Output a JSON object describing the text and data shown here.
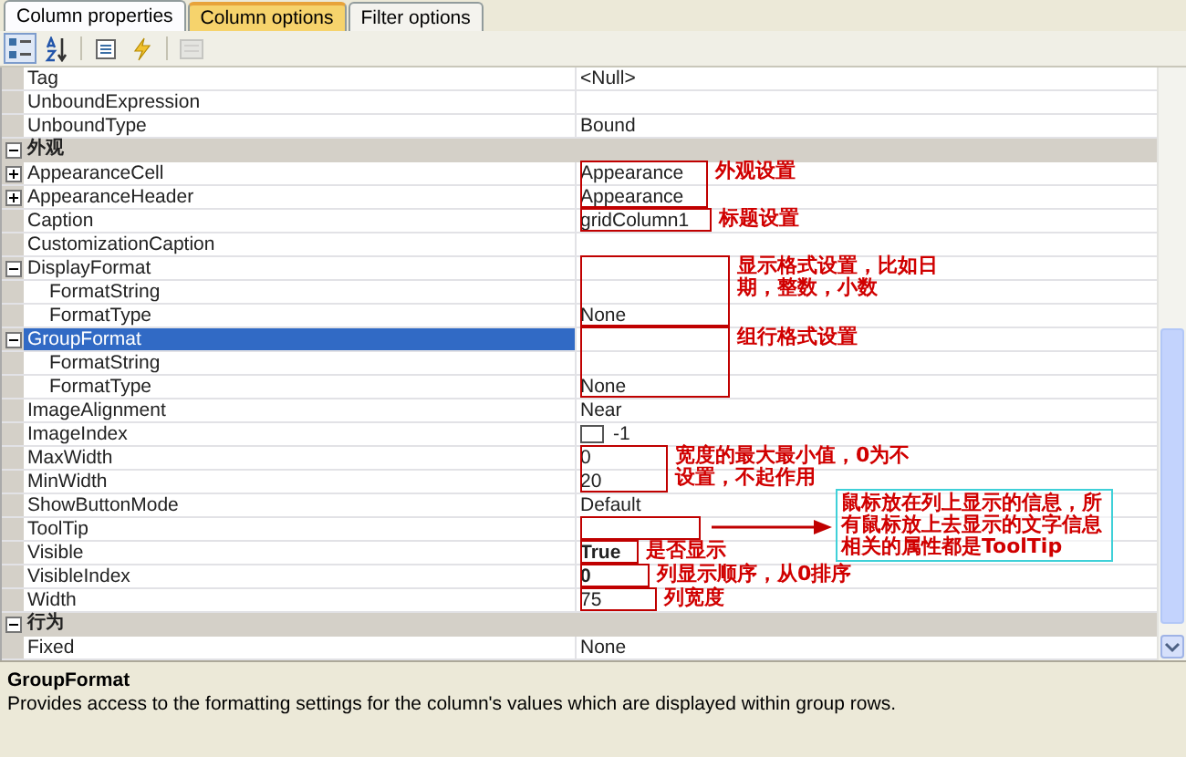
{
  "tabs": [
    {
      "label": "Column properties",
      "selected": true,
      "hovered": false
    },
    {
      "label": "Column options",
      "selected": false,
      "hovered": true
    },
    {
      "label": "Filter options",
      "selected": false,
      "hovered": false
    }
  ],
  "toolbar": [
    {
      "kind": "categorized",
      "selected": true,
      "disabled": false
    },
    {
      "kind": "alphabetical",
      "selected": false,
      "disabled": false
    },
    {
      "kind": "properties",
      "selected": false,
      "disabled": false
    },
    {
      "kind": "events",
      "selected": false,
      "disabled": false
    },
    {
      "kind": "pages",
      "selected": false,
      "disabled": true
    }
  ],
  "rows": [
    {
      "kind": "property",
      "name": "Tag",
      "value": "<Null>"
    },
    {
      "kind": "property",
      "name": "UnboundExpression"
    },
    {
      "kind": "property",
      "name": "UnboundType",
      "value": "Bound"
    },
    {
      "kind": "category",
      "name": "外观",
      "expanded": true,
      "children": [
        {
          "kind": "property",
          "name": "AppearanceCell",
          "value": "Appearance",
          "expanded": false
        },
        {
          "kind": "property",
          "name": "AppearanceHeader",
          "value": "Appearance",
          "expanded": false
        },
        {
          "kind": "property",
          "name": "Caption",
          "value": "gridColumn1"
        },
        {
          "kind": "property",
          "name": "CustomizationCaption"
        },
        {
          "kind": "property",
          "name": "DisplayFormat",
          "expanded": true,
          "children": [
            {
              "kind": "property",
              "name": "FormatString"
            },
            {
              "kind": "property",
              "name": "FormatType",
              "value": "None"
            }
          ]
        },
        {
          "kind": "property",
          "name": "GroupFormat",
          "expanded": true,
          "selected": true,
          "children": [
            {
              "kind": "property",
              "name": "FormatString"
            },
            {
              "kind": "property",
              "name": "FormatType",
              "value": "None"
            }
          ]
        },
        {
          "kind": "property",
          "name": "ImageAlignment",
          "value": "Near"
        },
        {
          "kind": "image-index",
          "name": "ImageIndex",
          "value": "-1"
        },
        {
          "kind": "property",
          "name": "MaxWidth",
          "value": "0"
        },
        {
          "kind": "property",
          "name": "MinWidth",
          "value": "20"
        },
        {
          "kind": "property",
          "name": "ShowButtonMode",
          "value": "Default"
        },
        {
          "kind": "property",
          "name": "ToolTip"
        },
        {
          "kind": "property",
          "name": "Visible",
          "value": "True",
          "modified": true
        },
        {
          "kind": "property",
          "name": "VisibleIndex",
          "value": "0",
          "modified": true
        },
        {
          "kind": "property",
          "name": "Width",
          "value": "75"
        }
      ]
    },
    {
      "kind": "category",
      "name": "行为",
      "expanded": true,
      "children": [
        {
          "kind": "property",
          "name": "Fixed",
          "value": "None"
        }
      ]
    }
  ],
  "annotations": [
    {
      "kind": "label",
      "text": "外观设置"
    },
    {
      "kind": "label",
      "text": "标题设置"
    },
    {
      "kind": "label",
      "text": "显示格式设置，比如日期，整数，小数"
    },
    {
      "kind": "label",
      "text": "组行格式设置"
    },
    {
      "kind": "label",
      "text": "宽度的最大最小值，0为不设置，不起作用"
    },
    {
      "kind": "pointer"
    },
    {
      "kind": "label",
      "text": "是否显示"
    },
    {
      "kind": "label",
      "text": "列显示顺序，从0排序"
    },
    {
      "kind": "label",
      "text": "列宽度"
    },
    {
      "kind": "callout",
      "text": "鼠标放在列上显示的信息，所有鼠标放上去显示的文字信息相关的属性都是ToolTip"
    }
  ],
  "description": {
    "title": "GroupFormat",
    "text": "Provides access to the formatting settings for the column's values which are displayed within group rows."
  }
}
